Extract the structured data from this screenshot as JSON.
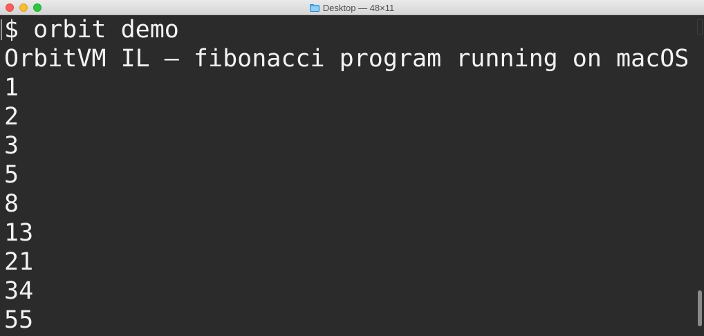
{
  "window": {
    "title": "Desktop — 48×11",
    "title_icon": "folder-icon"
  },
  "terminal": {
    "lines": [
      "$ orbit demo",
      "OrbitVM IL — fibonacci program running on macOS",
      "1",
      "2",
      "3",
      "5",
      "8",
      "13",
      "21",
      "34",
      "55"
    ]
  },
  "colors": {
    "background": "#2b2b2b",
    "text": "#f2f2f2",
    "close": "#fc5f57",
    "minimize": "#fdbc2e",
    "zoom": "#28c840"
  }
}
